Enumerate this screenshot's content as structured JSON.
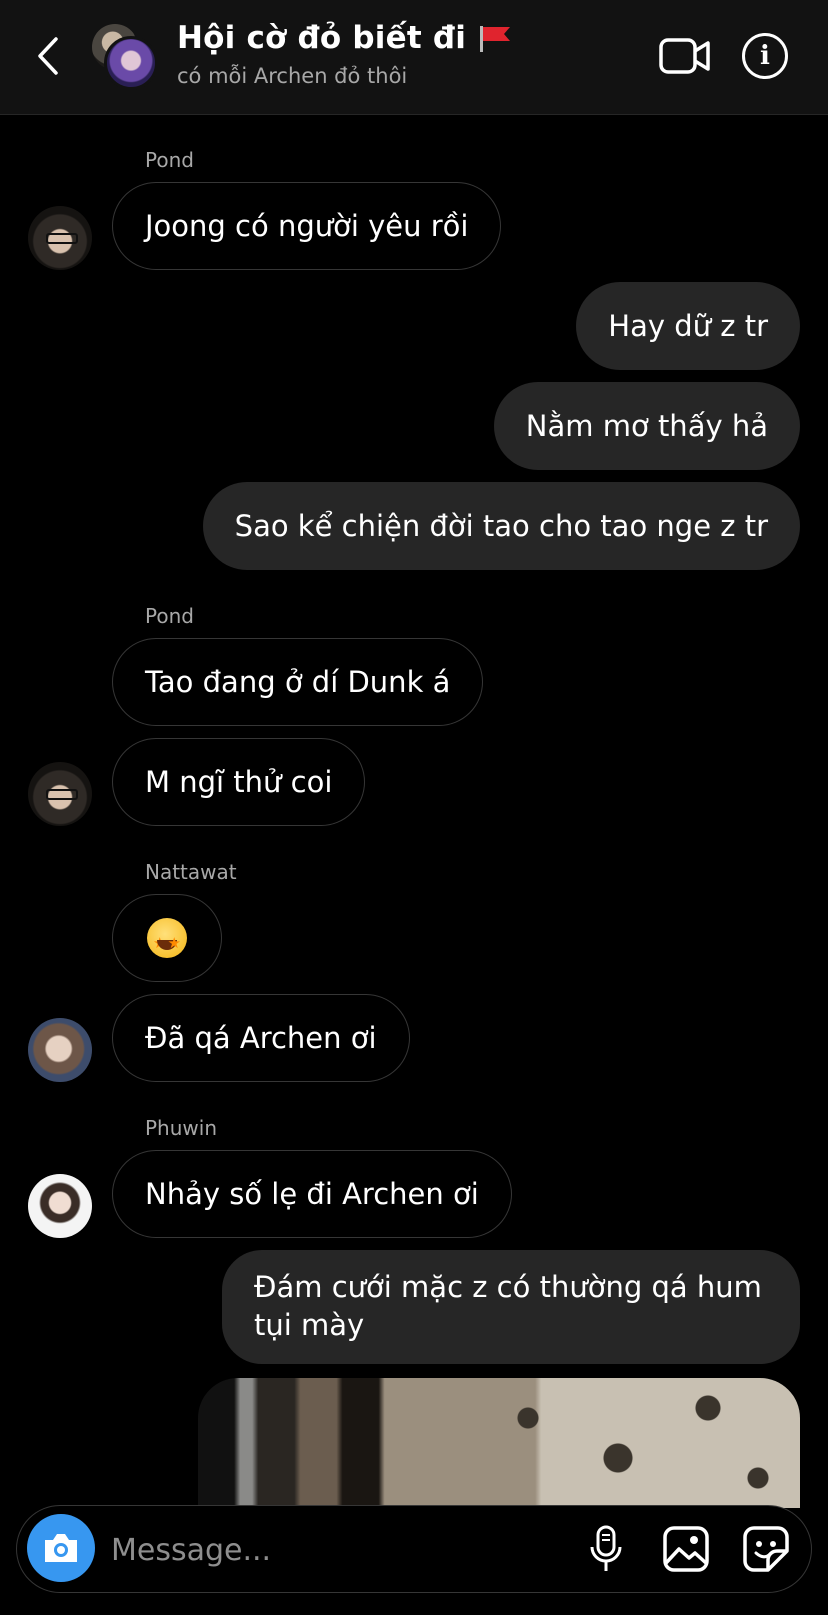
{
  "header": {
    "title": "Hội cờ đỏ biết đi",
    "subtitle": "có mỗi Archen đỏ thôi"
  },
  "messages": [
    {
      "sender": "Pond",
      "text": "Joong có người yêu rồi"
    },
    {
      "text": "Hay dữ z tr"
    },
    {
      "text": "Nằm mơ thấy hả"
    },
    {
      "text": "Sao kể chiện đời tao cho tao nge z tr"
    },
    {
      "sender": "Pond",
      "text": "Tao đang ở dí Dunk á"
    },
    {
      "text": "M ngĩ thử coi"
    },
    {
      "sender": "Nattawat",
      "emoji": "star-struck-emoji"
    },
    {
      "text": "Đã qá Archen ơi"
    },
    {
      "sender": "Phuwin",
      "text": "Nhảy số lẹ đi Archen ơi"
    },
    {
      "text": "Đám cưới mặc z có thường qá hum tụi mày"
    }
  ],
  "composer": {
    "placeholder": "Message..."
  },
  "colors": {
    "background": "#000000",
    "header_bg": "#121212",
    "outgoing_bubble": "#262626",
    "incoming_border": "#363636",
    "camera_button": "#3797f0",
    "secondary_text": "#a8a8a8"
  }
}
